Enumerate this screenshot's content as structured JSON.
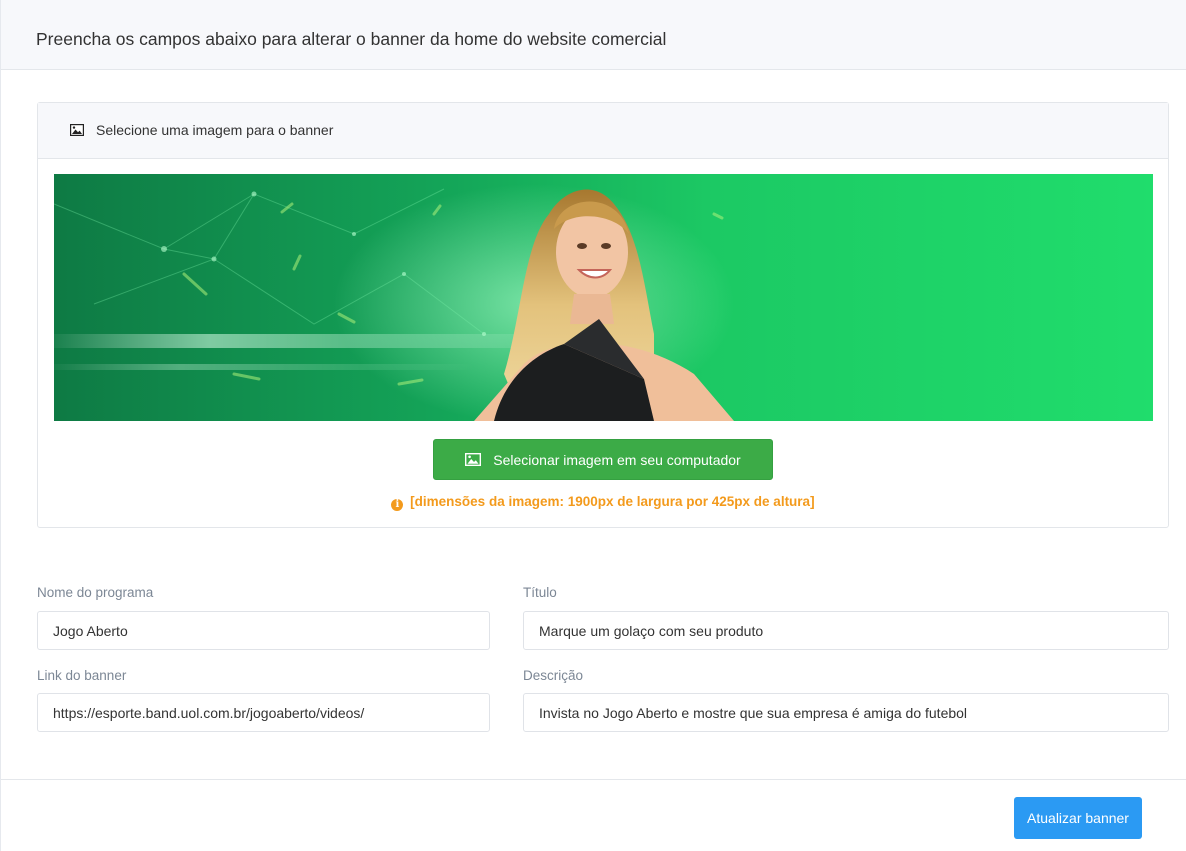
{
  "header": {
    "instruction": "Preencha os campos abaixo para alterar o banner da home do website comercial"
  },
  "image_card": {
    "title": "Selecione uma imagem para o banner",
    "title_icon": "image-icon",
    "select_button_label": "Selecionar imagem em seu computador",
    "select_button_icon": "image-icon",
    "dimensions_note": "[dimensões da imagem: 1900px de largura por 425px de altura]",
    "note_icon": "info-circle-icon"
  },
  "form": {
    "program_name": {
      "label": "Nome do programa",
      "value": "Jogo Aberto"
    },
    "title": {
      "label": "Título",
      "value": "Marque um golaço com seu produto"
    },
    "banner_link": {
      "label": "Link do banner",
      "value": "https://esporte.band.uol.com.br/jogoaberto/videos/"
    },
    "description": {
      "label": "Descrição",
      "value": "Invista no Jogo Aberto e mostre que sua empresa é amiga do futebol"
    }
  },
  "footer": {
    "update_button_label": "Atualizar banner"
  },
  "colors": {
    "green_button": "#3cab47",
    "blue_button": "#2b9af3",
    "warning_orange": "#f39a1c",
    "banner_green": "#1ed868"
  }
}
